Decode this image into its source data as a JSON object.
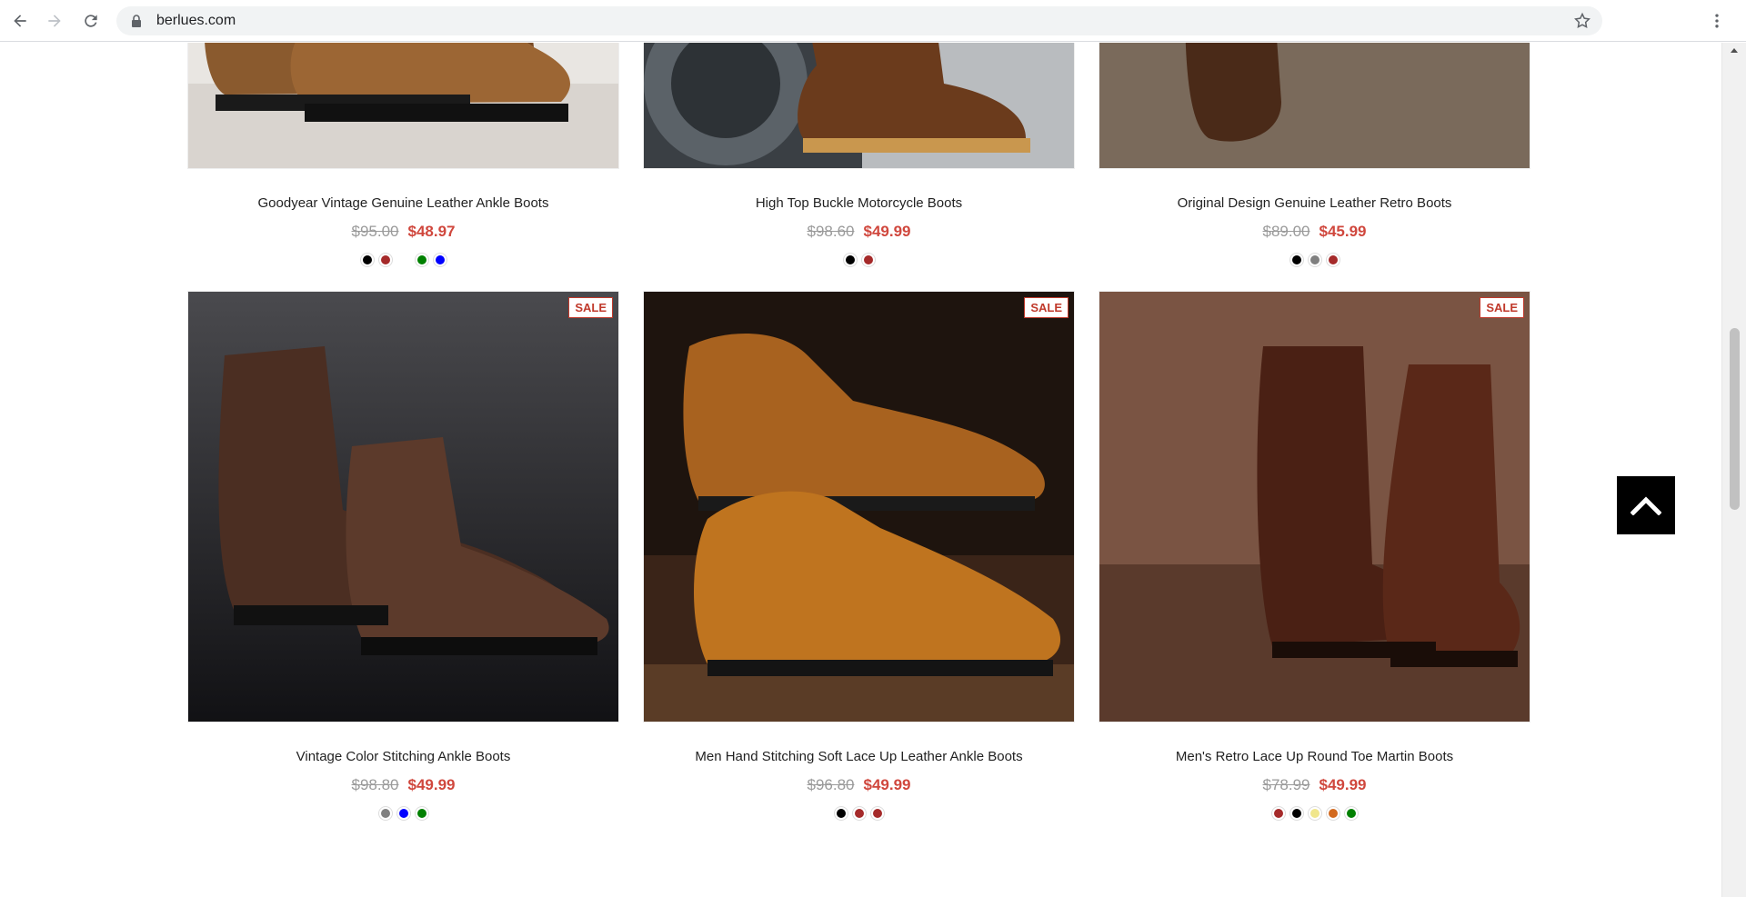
{
  "browser": {
    "url": "berlues.com"
  },
  "products": [
    {
      "title": "Goodyear Vintage Genuine Leather Ankle Boots",
      "old_price": "$95.00",
      "new_price": "$48.97",
      "swatches": [
        "#000000",
        "#a52a2a",
        "",
        "#008000",
        "#0000ff"
      ],
      "sale": false,
      "image_style": "tan-boots"
    },
    {
      "title": "High Top Buckle Motorcycle Boots",
      "old_price": "$98.60",
      "new_price": "$49.99",
      "swatches": [
        "#000000",
        "#a52a2a"
      ],
      "sale": false,
      "image_style": "moto-boots"
    },
    {
      "title": "Original Design Genuine Leather Retro Boots",
      "old_price": "$89.00",
      "new_price": "$45.99",
      "swatches": [
        "#000000",
        "#808080",
        "#a52a2a"
      ],
      "sale": false,
      "image_style": "retro-boots"
    },
    {
      "title": "Vintage Color Stitching Ankle Boots",
      "old_price": "$98.80",
      "new_price": "$49.99",
      "swatches": [
        "#808080",
        "#0000ff",
        "#008000"
      ],
      "sale": true,
      "sale_label": "SALE",
      "image_style": "brogue-boots"
    },
    {
      "title": "Men Hand Stitching Soft Lace Up Leather Ankle Boots",
      "old_price": "$96.80",
      "new_price": "$49.99",
      "swatches": [
        "#000000",
        "#a52a2a",
        "#a52a2a"
      ],
      "sale": true,
      "sale_label": "SALE",
      "image_style": "stitch-boots"
    },
    {
      "title": "Men's Retro Lace Up Round Toe Martin Boots",
      "old_price": "$78.99",
      "new_price": "$49.99",
      "swatches": [
        "#a52a2a",
        "#000000",
        "#f0e68c",
        "#d2691e",
        "#008000"
      ],
      "sale": true,
      "sale_label": "SALE",
      "image_style": "martin-boots"
    }
  ]
}
